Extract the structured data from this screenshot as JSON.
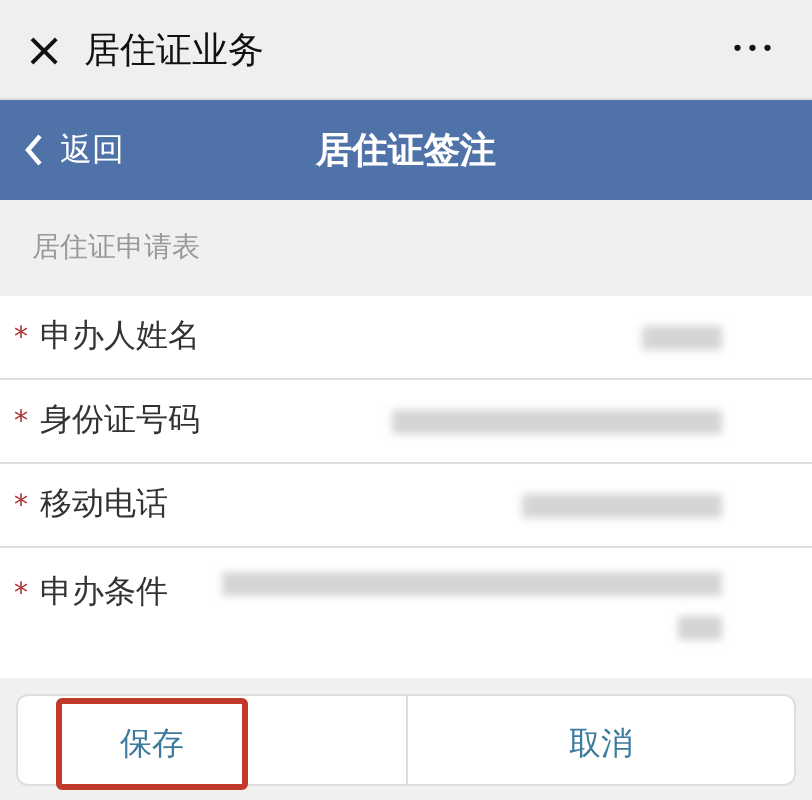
{
  "top_bar": {
    "close_icon": "×",
    "title": "居住证业务",
    "more": "•••"
  },
  "nav_bar": {
    "back": "返回",
    "title": "居住证签注"
  },
  "section": {
    "title": "居住证申请表"
  },
  "fields": [
    {
      "required_mark": "*",
      "label": "申办人姓名",
      "kind": "short"
    },
    {
      "required_mark": "*",
      "label": "身份证号码",
      "kind": "long"
    },
    {
      "required_mark": "*",
      "label": "移动电话",
      "kind": "medium"
    },
    {
      "required_mark": "*",
      "label": "申办条件",
      "kind": "multiline"
    }
  ],
  "buttons": [
    {
      "label": "保存",
      "highlighted": true
    },
    {
      "label": "取消",
      "highlighted": false
    }
  ]
}
